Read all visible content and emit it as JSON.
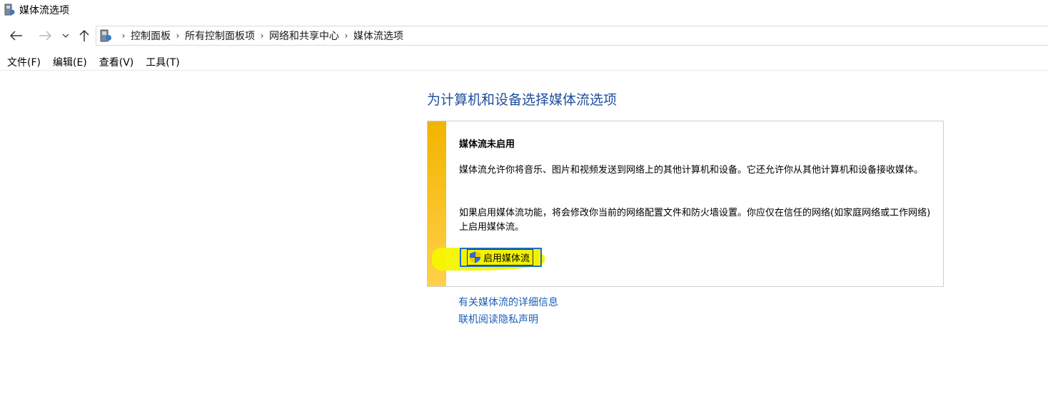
{
  "window": {
    "title": "媒体流选项",
    "icon": "media-streaming-icon"
  },
  "navigation": {
    "back_icon": "back-arrow-icon",
    "forward_icon": "forward-arrow-icon",
    "recent_icon": "chevron-down-icon",
    "up_icon": "up-arrow-icon",
    "breadcrumb": [
      "控制面板",
      "所有控制面板项",
      "网络和共享中心",
      "媒体流选项"
    ],
    "separator": "›"
  },
  "menu": {
    "items": [
      "文件(F)",
      "编辑(E)",
      "查看(V)",
      "工具(T)"
    ]
  },
  "content": {
    "title": "为计算机和设备选择媒体流选项",
    "panel": {
      "heading": "媒体流未启用",
      "para1": "媒体流允许你将音乐、图片和视频发送到网络上的其他计算机和设备。它还允许你从其他计算机和设备接收媒体。",
      "para2": "如果启用媒体流功能，将会修改你当前的网络配置文件和防火墙设置。你应仅在信任的网络(如家庭网络或工作网络)上启用媒体流。",
      "button_label": "启用媒体流",
      "button_icon": "uac-shield-icon",
      "accent_color": "#f2b400",
      "highlight_color": "#f5f500"
    },
    "links": {
      "details": "有关媒体流的详细信息",
      "privacy": "联机阅读隐私声明"
    },
    "title_color": "#1f4e9c",
    "link_color": "#1c5fb8"
  }
}
